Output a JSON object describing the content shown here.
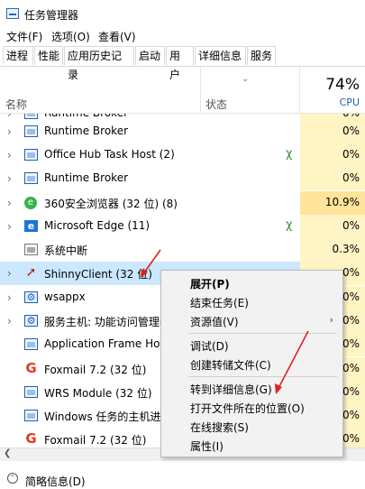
{
  "window": {
    "title": "任务管理器"
  },
  "menubar": {
    "items": [
      "文件(F)",
      "选项(O)",
      "查看(V)"
    ]
  },
  "tabs": [
    "进程",
    "性能",
    "应用历史记录",
    "启动",
    "用户",
    "详细信息",
    "服务"
  ],
  "header": {
    "name": "名称",
    "status": "状态",
    "cpu_percent": "74%",
    "cpu_label": "CPU"
  },
  "rows": [
    {
      "name": "Runtime Broker",
      "cpu": "0%"
    },
    {
      "name": "Office Hub Task Host (2)",
      "cpu": "0%"
    },
    {
      "name": "Runtime Broker",
      "cpu": "0%"
    },
    {
      "name": "360安全浏览器 (32 位) (8)",
      "cpu": "10.9%"
    },
    {
      "name": "Microsoft Edge (11)",
      "cpu": "0%"
    },
    {
      "name": "系统中断",
      "cpu": "0.3%"
    },
    {
      "name": "ShinnyClient (32 位)",
      "cpu": "0%"
    },
    {
      "name": "wsappx",
      "cpu": "0%"
    },
    {
      "name": "服务主机: 功能访问管理器",
      "cpu": "0%"
    },
    {
      "name": "Application Frame Host",
      "cpu": "0%"
    },
    {
      "name": "Foxmail 7.2 (32 位)",
      "cpu": "0%"
    },
    {
      "name": "WRS Module (32 位)",
      "cpu": "0%"
    },
    {
      "name": "Windows 任务的主机进程",
      "cpu": "0%"
    },
    {
      "name": "Foxmail 7.2 (32 位)",
      "cpu": "0%"
    }
  ],
  "context_menu": {
    "items": [
      "展开(P)",
      "结束任务(E)",
      "资源值(V)",
      "调试(D)",
      "创建转储文件(C)",
      "转到详细信息(G)",
      "打开文件所在的位置(O)",
      "在线搜索(S)",
      "属性(I)"
    ]
  },
  "footer": {
    "fewer_details": "简略信息(D)"
  },
  "colors": {
    "accent": "#1f5fb5",
    "cpu_low": "#fff4c4",
    "cpu_med": "#ffe49a",
    "selected": "#cce8ff",
    "annotation": "#e02020"
  }
}
